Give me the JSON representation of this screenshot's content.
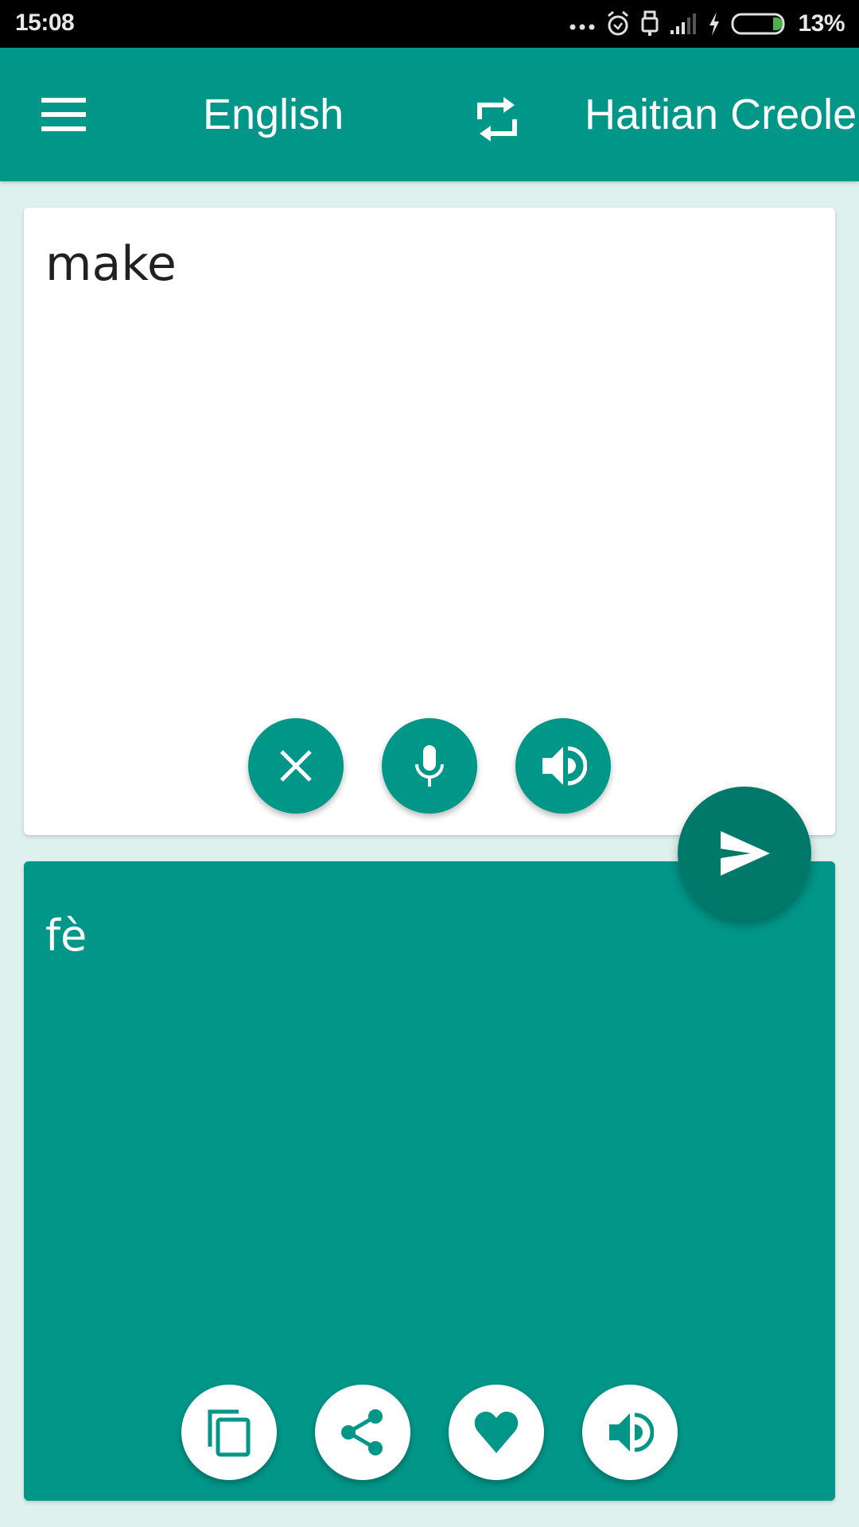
{
  "status_bar": {
    "time": "15:08",
    "battery_percent": "13%",
    "battery_level": 0.13,
    "icons": [
      "more-dots-icon",
      "alarm-icon",
      "usb-icon",
      "signal-icon",
      "charging-icon",
      "battery-icon"
    ]
  },
  "toolbar": {
    "menu_icon": "hamburger-menu-icon",
    "source_language": "English",
    "swap_icon": "swap-languages-icon",
    "target_language": "Haitian Creole"
  },
  "input_card": {
    "text": "make",
    "buttons": [
      {
        "name": "clear",
        "icon": "close-icon"
      },
      {
        "name": "voice-input",
        "icon": "microphone-icon"
      },
      {
        "name": "speak-source",
        "icon": "speaker-icon"
      }
    ]
  },
  "translate_button": {
    "icon": "send-icon"
  },
  "output_card": {
    "text": "fè",
    "buttons": [
      {
        "name": "copy",
        "icon": "copy-icon"
      },
      {
        "name": "share",
        "icon": "share-icon"
      },
      {
        "name": "favorite",
        "icon": "heart-icon"
      },
      {
        "name": "speak-translation",
        "icon": "speaker-icon"
      }
    ]
  },
  "colors": {
    "primary": "#009688",
    "primary_dark": "#00796b",
    "background": "#dff1ef",
    "battery_green": "#4caf50"
  }
}
